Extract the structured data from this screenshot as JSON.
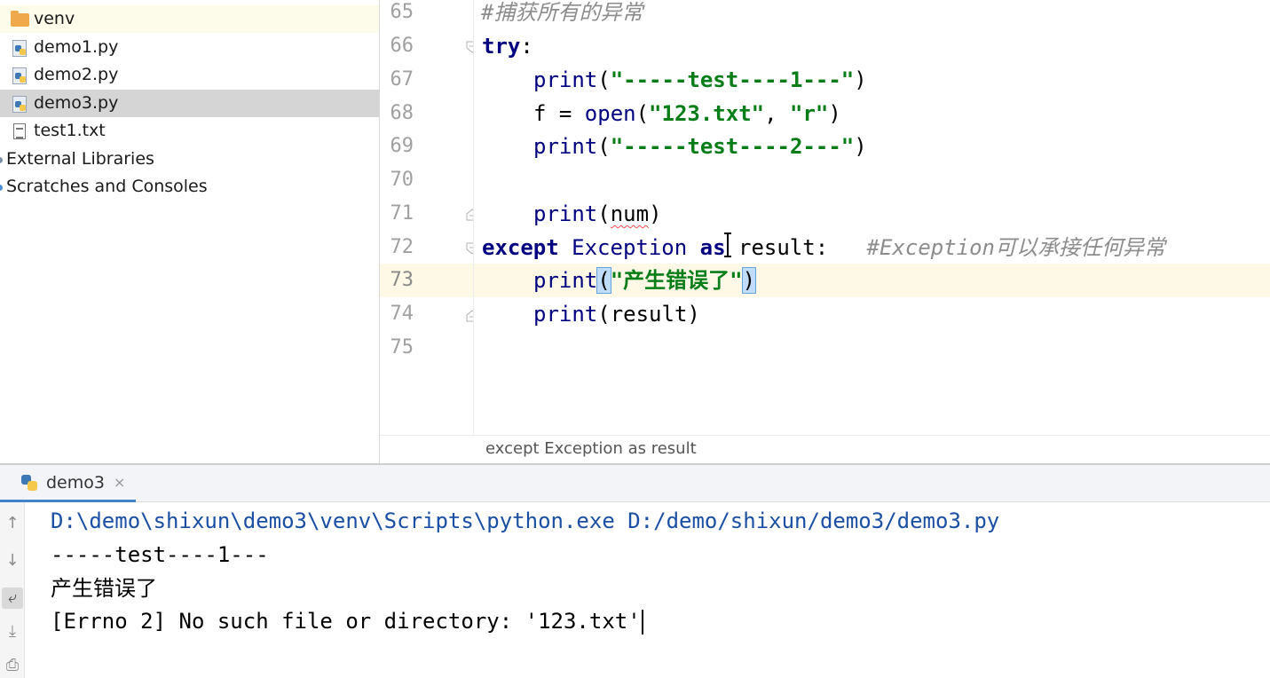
{
  "project_tree": {
    "items": [
      {
        "label": "venv",
        "icon": "folder-icon"
      },
      {
        "label": "demo1.py",
        "icon": "python-file-icon"
      },
      {
        "label": "demo2.py",
        "icon": "python-file-icon"
      },
      {
        "label": "demo3.py",
        "icon": "python-file-icon"
      },
      {
        "label": "test1.txt",
        "icon": "text-file-icon"
      },
      {
        "label": "External Libraries",
        "icon": "library-icon"
      },
      {
        "label": "Scratches and Consoles",
        "icon": "scratches-icon"
      }
    ],
    "selected": "demo3.py"
  },
  "editor": {
    "current_line": "73",
    "lines": [
      {
        "num": "65",
        "comment": "#捕获所有的异常"
      },
      {
        "num": "66",
        "kw": "try",
        "rest": ":"
      },
      {
        "num": "67",
        "fn": "print",
        "open": "(",
        "str": "\"-----test----1---\"",
        "close": ")"
      },
      {
        "num": "68",
        "pre": "f = ",
        "fn": "open",
        "open": "(",
        "str": "\"123.txt\"",
        "mid": ", ",
        "str2": "\"r\"",
        "close": ")"
      },
      {
        "num": "69",
        "fn": "print",
        "open": "(",
        "str": "\"-----test----2---\"",
        "close": ")"
      },
      {
        "num": "70"
      },
      {
        "num": "71",
        "fn": "print",
        "open": "(",
        "arg": "num",
        "close": ")"
      },
      {
        "num": "72",
        "kw": "except",
        "cls": "Exception",
        "kw2": "as",
        "rest": " result:",
        "comment": "#Exception可以承接任何异常"
      },
      {
        "num": "73",
        "fn": "print",
        "open": "(",
        "str": "\"产生错误了\"",
        "close": ")"
      },
      {
        "num": "74",
        "fn": "print",
        "open": "(",
        "arg": "result",
        "close": ")"
      },
      {
        "num": "75"
      }
    ],
    "breadcrumb": "except Exception as result"
  },
  "run_panel": {
    "tab_label": "demo3",
    "tab_close": "×",
    "output": [
      "D:\\demo\\shixun\\demo3\\venv\\Scripts\\python.exe D:/demo/shixun/demo3/demo3.py",
      "-----test----1---",
      "产生错误了",
      "[Errno 2] No such file or directory: '123.txt'"
    ],
    "toolbar": [
      {
        "icon": "up-arrow-icon",
        "glyph": "↑"
      },
      {
        "icon": "down-arrow-icon",
        "glyph": "↓"
      },
      {
        "icon": "soft-wrap-icon",
        "glyph": "⤶"
      },
      {
        "icon": "scroll-to-end-icon",
        "glyph": "⤓"
      },
      {
        "icon": "print-icon",
        "glyph": "⎙"
      }
    ]
  },
  "colors": {
    "keyword": "#000080",
    "string": "#067d17",
    "comment": "#8c8c8c",
    "selection": "#d5d5d5",
    "current_line": "#fdf9e6",
    "console_path": "#1a4fa3"
  }
}
